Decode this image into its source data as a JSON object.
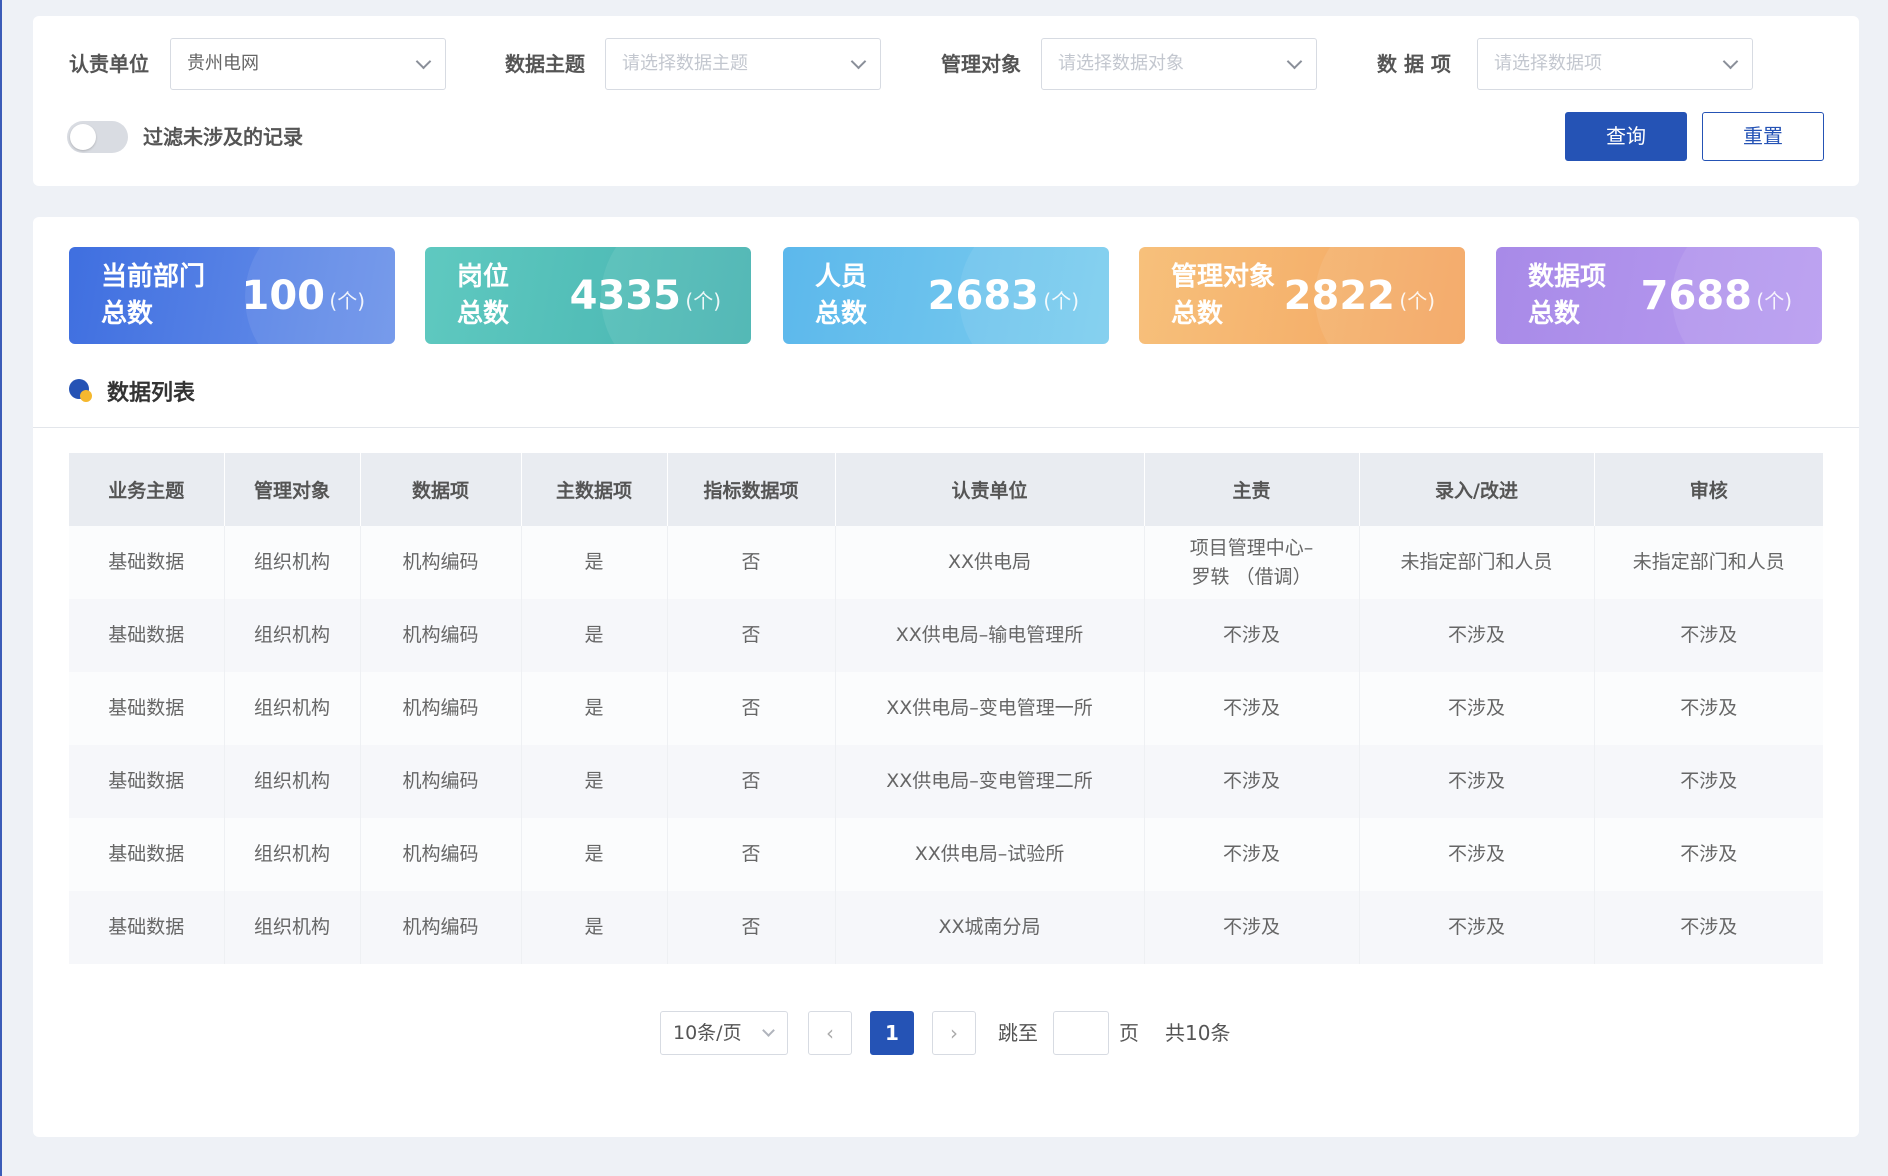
{
  "filters": {
    "unit_label": "认责单位",
    "unit_value": "贵州电网",
    "theme_label": "数据主题",
    "theme_placeholder": "请选择数据主题",
    "object_label": "管理对象",
    "object_placeholder": "请选择数据对象",
    "item_label": "数 据 项",
    "item_placeholder": "请选择数据项",
    "toggle_label": "过滤未涉及的记录",
    "query_label": "查询",
    "reset_label": "重置"
  },
  "stats": [
    {
      "label_line1": "当前部门",
      "label_line2": "总数",
      "value": "100",
      "unit": "(个)",
      "color_from": "#3f6fe0",
      "color_to": "#6c93ea"
    },
    {
      "label_line1": "岗位",
      "label_line2": "总数",
      "value": "4335",
      "unit": "(个)",
      "color_from": "#5fc9c0",
      "color_to": "#46b3b0"
    },
    {
      "label_line1": "人员",
      "label_line2": "总数",
      "value": "2683",
      "unit": "(个)",
      "color_from": "#5cb8ec",
      "color_to": "#7ccdee"
    },
    {
      "label_line1": "管理对象",
      "label_line2": "总数",
      "value": "2822",
      "unit": "(个)",
      "color_from": "#f7c07b",
      "color_to": "#f3a560"
    },
    {
      "label_line1": "数据项",
      "label_line2": "总数",
      "value": "7688",
      "unit": "(个)",
      "color_from": "#a88ae8",
      "color_to": "#b89cf0"
    }
  ],
  "section_title": "数据列表",
  "table": {
    "headers": [
      "业务主题",
      "管理对象",
      "数据项",
      "主数据项",
      "指标数据项",
      "认责单位",
      "主责",
      "录入/改进",
      "审核"
    ],
    "rows": [
      [
        "基础数据",
        "组织机构",
        "机构编码",
        "是",
        "否",
        "XX供电局",
        "项目管理中心–\n罗轶 （借调）",
        "未指定部门和人员",
        "未指定部门和人员"
      ],
      [
        "基础数据",
        "组织机构",
        "机构编码",
        "是",
        "否",
        "XX供电局–输电管理所",
        "不涉及",
        "不涉及",
        "不涉及"
      ],
      [
        "基础数据",
        "组织机构",
        "机构编码",
        "是",
        "否",
        "XX供电局–变电管理一所",
        "不涉及",
        "不涉及",
        "不涉及"
      ],
      [
        "基础数据",
        "组织机构",
        "机构编码",
        "是",
        "否",
        "XX供电局–变电管理二所",
        "不涉及",
        "不涉及",
        "不涉及"
      ],
      [
        "基础数据",
        "组织机构",
        "机构编码",
        "是",
        "否",
        "XX供电局–试验所",
        "不涉及",
        "不涉及",
        "不涉及"
      ],
      [
        "基础数据",
        "组织机构",
        "机构编码",
        "是",
        "否",
        "XX城南分局",
        "不涉及",
        "不涉及",
        "不涉及"
      ]
    ]
  },
  "pagination": {
    "page_size": "10条/页",
    "prev_icon": "‹",
    "current_page": "1",
    "next_icon": "›",
    "jump_label": "跳至",
    "page_label": "页",
    "total_label": "共10条"
  }
}
